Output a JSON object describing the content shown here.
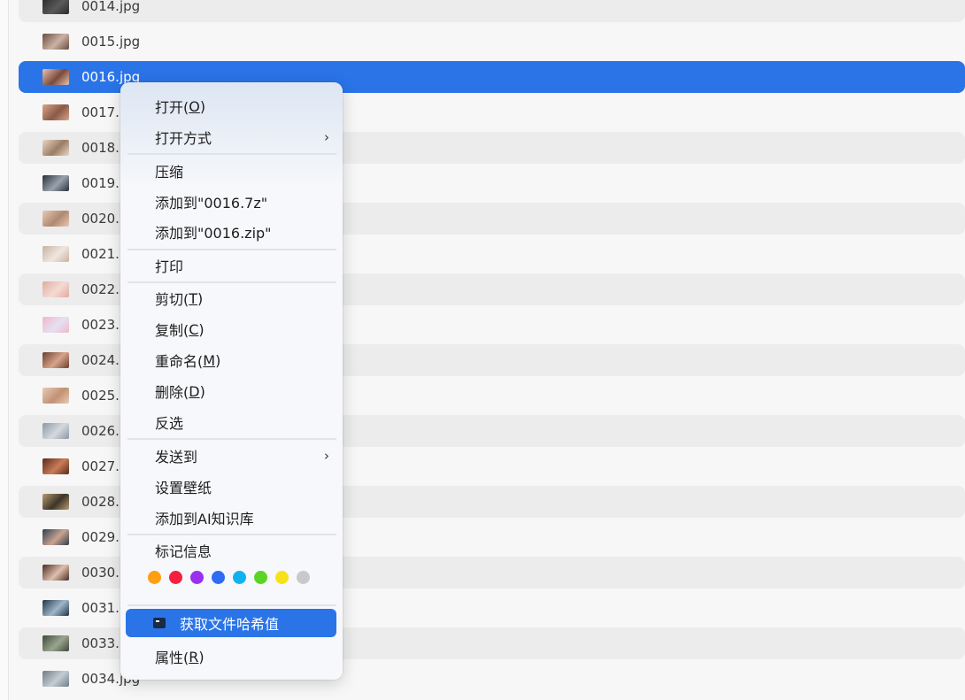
{
  "files": [
    {
      "name": "0014.jpg",
      "thumb": [
        "#2b2b2b",
        "#5a5a5a"
      ]
    },
    {
      "name": "0015.jpg",
      "thumb": [
        "#6e4b3f",
        "#c9b3a6"
      ]
    },
    {
      "name": "0016.jpg",
      "thumb": [
        "#e9c3b0",
        "#7a4a3c"
      ],
      "selected": true
    },
    {
      "name": "0017.",
      "thumb": [
        "#d9a488",
        "#8a5a48"
      ]
    },
    {
      "name": "0018.",
      "thumb": [
        "#e8d7c8",
        "#9b7c63"
      ]
    },
    {
      "name": "0019.",
      "thumb": [
        "#2a2f3a",
        "#9aa3ad"
      ]
    },
    {
      "name": "0020.",
      "thumb": [
        "#e6c9b8",
        "#b08870"
      ]
    },
    {
      "name": "0021.",
      "thumb": [
        "#c8b2a0",
        "#f0e6df"
      ]
    },
    {
      "name": "0022.",
      "thumb": [
        "#e3a8a0",
        "#f3dcd4"
      ]
    },
    {
      "name": "0023.",
      "thumb": [
        "#f1b8c8",
        "#e6e0f3"
      ]
    },
    {
      "name": "0024.",
      "thumb": [
        "#6b3f2f",
        "#d7a48a"
      ]
    },
    {
      "name": "0025.",
      "thumb": [
        "#e8cbb8",
        "#c29172"
      ]
    },
    {
      "name": "0026.",
      "thumb": [
        "#8a97a6",
        "#d6d9de"
      ]
    },
    {
      "name": "0027.",
      "thumb": [
        "#5a2a1e",
        "#c97c58"
      ]
    },
    {
      "name": "0028.",
      "thumb": [
        "#b89a73",
        "#3c3428"
      ]
    },
    {
      "name": "0029.",
      "thumb": [
        "#2f3d52",
        "#c9a38f"
      ]
    },
    {
      "name": "0030.",
      "thumb": [
        "#4a2c24",
        "#e0bfae"
      ]
    },
    {
      "name": "0031.",
      "thumb": [
        "#23354a",
        "#9fb6c9"
      ]
    },
    {
      "name": "0033.",
      "thumb": [
        "#3d4a3a",
        "#9aa58f"
      ]
    },
    {
      "name": "0034.jpg",
      "thumb": [
        "#6f7d88",
        "#c4ccd3"
      ]
    }
  ],
  "menu": {
    "open": "打开(",
    "open_key": "O",
    "open_with": "打开方式",
    "compress": "压缩",
    "add_7z": "添加到\"0016.7z\"",
    "add_zip": "添加到\"0016.zip\"",
    "print": "打印",
    "cut": "剪切(",
    "cut_key": "T",
    "copy": "复制(",
    "copy_key": "C",
    "rename": "重命名(",
    "rename_key": "M",
    "delete": "删除(",
    "delete_key": "D",
    "invert": "反选",
    "send_to": "发送到",
    "set_wallpaper": "设置壁纸",
    "add_ai": "添加到AI知识库",
    "tag_info": "标记信息",
    "hash": "获取文件哈希值",
    "properties": "属性(",
    "properties_key": "R",
    "close_paren": ")",
    "submenu_arrow": "›",
    "tag_colors": [
      "#ff9f10",
      "#f4203f",
      "#9b2ff0",
      "#2e6cf2",
      "#10b2ee",
      "#5ad524",
      "#f6e21a",
      "#c9c9c9"
    ]
  },
  "colors": {
    "selection": "#2a74e8",
    "row_alt": "#ececec"
  }
}
